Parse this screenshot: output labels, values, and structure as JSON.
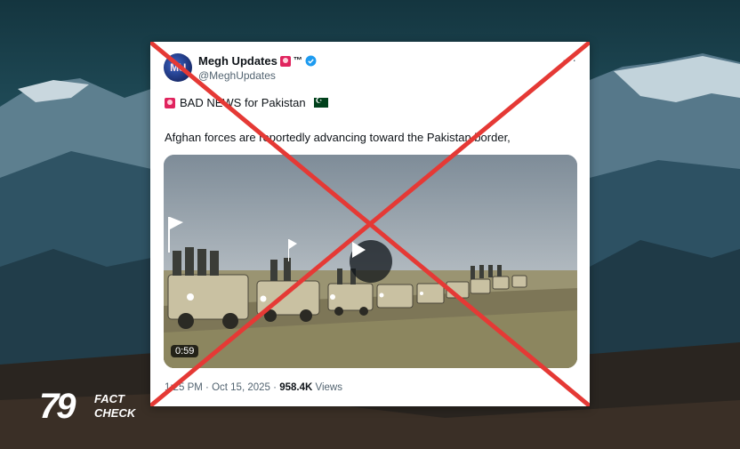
{
  "tweet": {
    "display_name": "Megh Updates",
    "tm": "™",
    "handle": "@MeghUpdates",
    "avatar_text": "MU",
    "more": "···",
    "text_line1": "BAD NEWS for Pakistan",
    "text_line2": "Afghan forces are reportedly advancing toward the Pakistan border,",
    "video_duration": "0:59",
    "time": "1:25 PM",
    "date": "Oct 15, 2025",
    "views_count": "958.4K",
    "views_label": "Views",
    "separator": "·"
  },
  "logo": {
    "digits": "79",
    "fact": "FACT",
    "check": "CHECK"
  },
  "colors": {
    "cross": "#e53935",
    "verified": "#1d9bf0",
    "background": "#1f4552"
  },
  "icons": [
    "siren-icon",
    "verified-badge-icon",
    "pakistan-flag-icon",
    "play-icon",
    "more-options-icon"
  ]
}
